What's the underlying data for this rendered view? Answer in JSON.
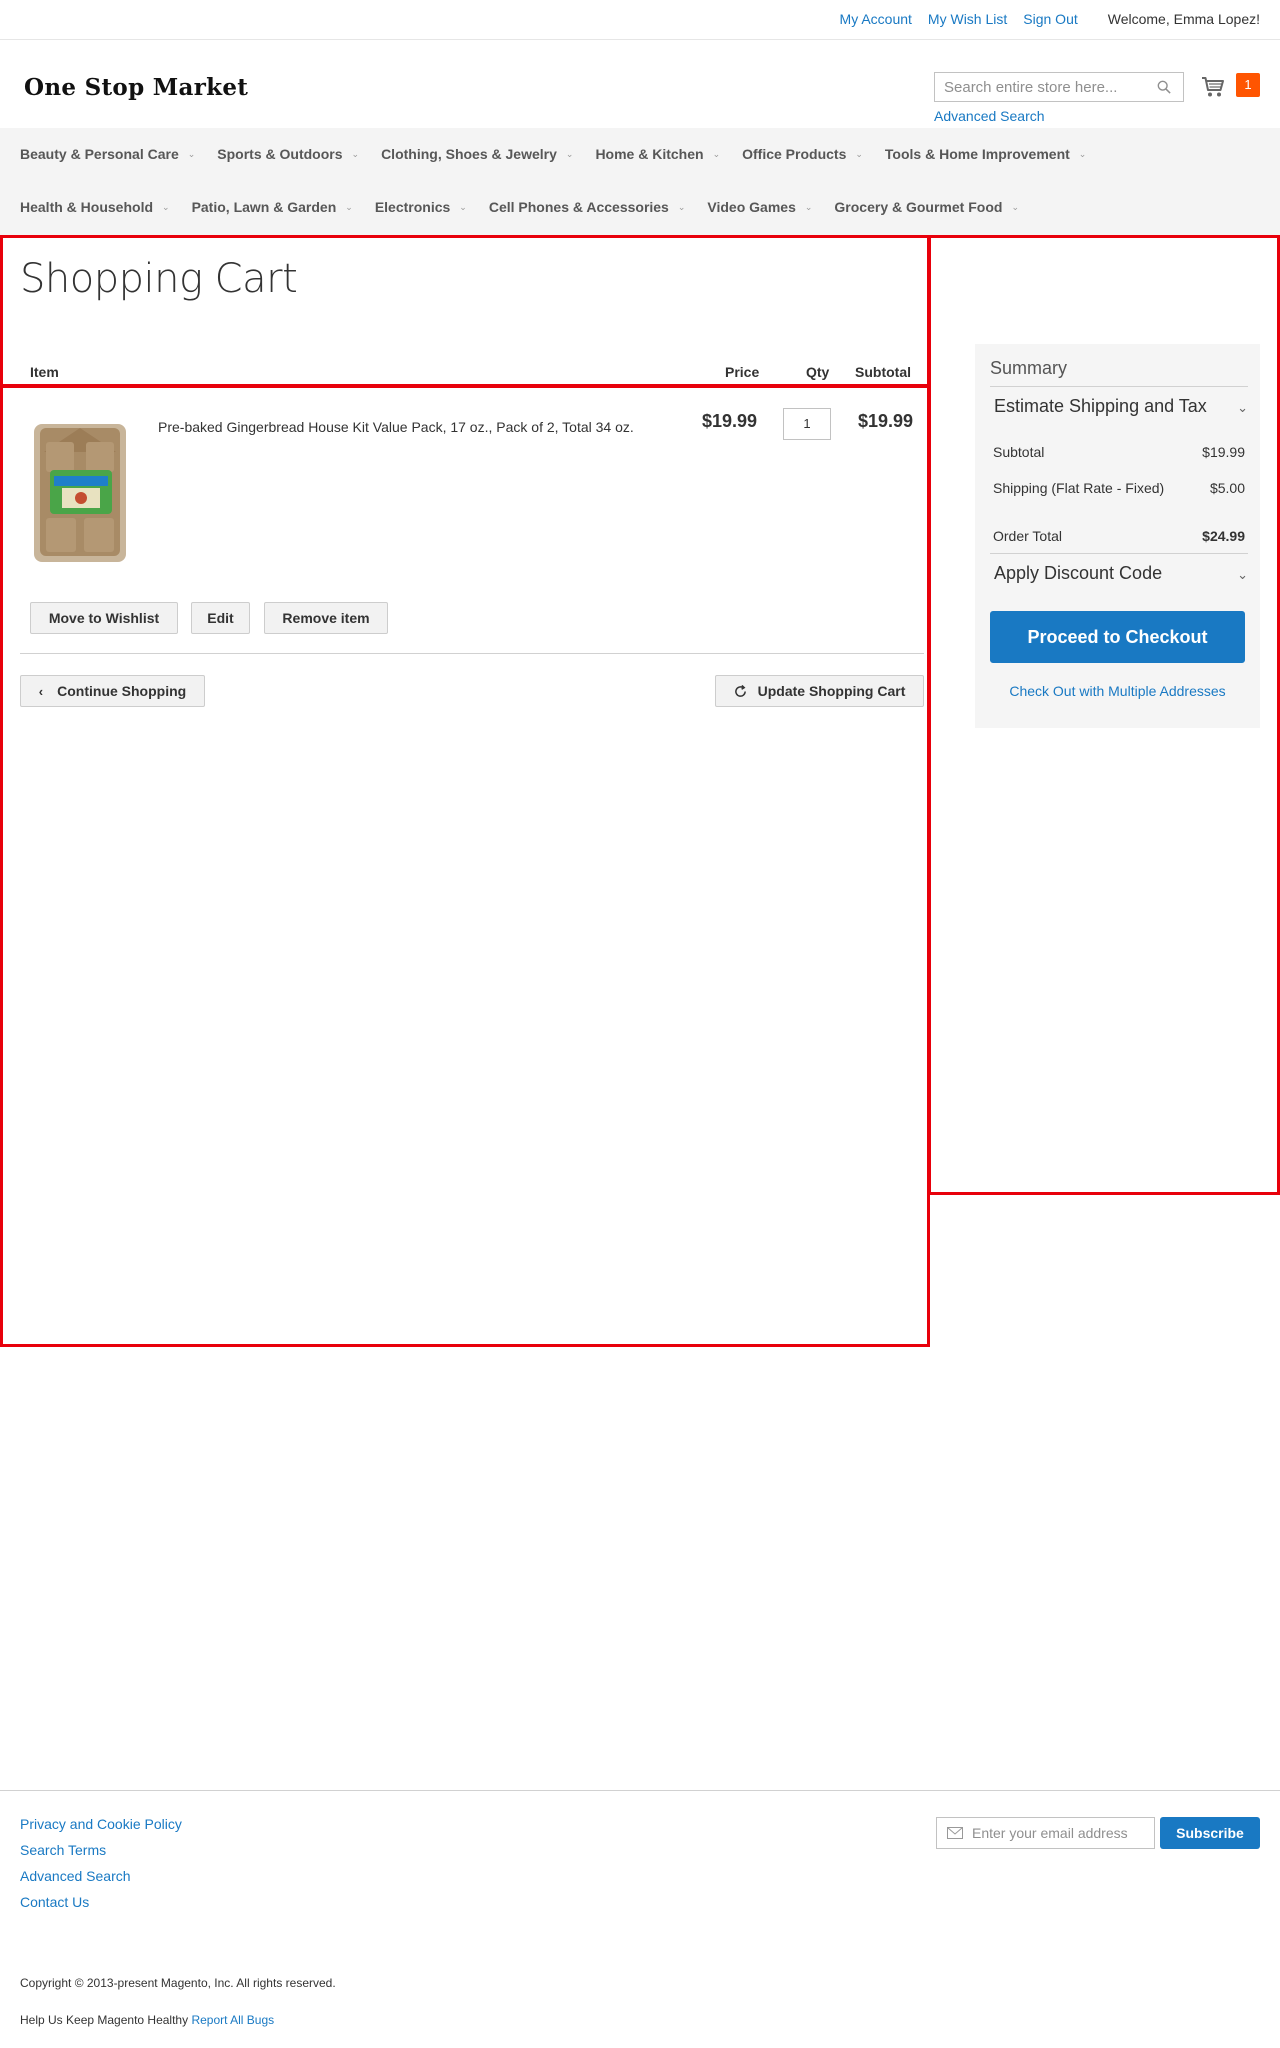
{
  "header": {
    "links": [
      "My Account",
      "My Wish List",
      "Sign Out"
    ],
    "welcome": "Welcome, Emma Lopez!",
    "logo": "One Stop Market",
    "search_placeholder": "Search entire store here...",
    "advanced_search": "Advanced Search",
    "cart_count": "1"
  },
  "nav": {
    "row1": [
      "Beauty & Personal Care",
      "Sports & Outdoors",
      "Clothing, Shoes & Jewelry",
      "Home & Kitchen",
      "Office Products",
      "Tools & Home Improvement"
    ],
    "row2": [
      "Health & Household",
      "Patio, Lawn & Garden",
      "Electronics",
      "Cell Phones & Accessories",
      "Video Games",
      "Grocery & Gourmet Food"
    ]
  },
  "cart": {
    "title": "Shopping Cart",
    "columns": {
      "item": "Item",
      "price": "Price",
      "qty": "Qty",
      "subtotal": "Subtotal"
    },
    "item": {
      "name": "Pre-baked Gingerbread House Kit Value Pack, 17 oz., Pack of 2, Total 34 oz.",
      "price": "$19.99",
      "qty": "1",
      "subtotal": "$19.99"
    },
    "actions": {
      "wishlist": "Move to Wishlist",
      "edit": "Edit",
      "remove": "Remove item"
    },
    "continue": "Continue Shopping",
    "update": "Update Shopping Cart"
  },
  "summary": {
    "title": "Summary",
    "estimate": "Estimate Shipping and Tax",
    "subtotal_label": "Subtotal",
    "subtotal_value": "$19.99",
    "shipping_label": "Shipping (Flat Rate - Fixed)",
    "shipping_value": "$5.00",
    "total_label": "Order Total",
    "total_value": "$24.99",
    "discount": "Apply Discount Code",
    "checkout": "Proceed to Checkout",
    "multi": "Check Out with Multiple Addresses"
  },
  "footer": {
    "links": [
      "Privacy and Cookie Policy",
      "Search Terms",
      "Advanced Search",
      "Contact Us"
    ],
    "email_placeholder": "Enter your email address",
    "subscribe": "Subscribe",
    "copyright": "Copyright © 2013-present Magento, Inc. All rights reserved.",
    "help_text": "Help Us Keep Magento Healthy",
    "report_link": "Report All Bugs"
  },
  "colors": {
    "accent": "#1979c3",
    "cart_badge": "#ff5501",
    "highlight": "#e8000b"
  }
}
